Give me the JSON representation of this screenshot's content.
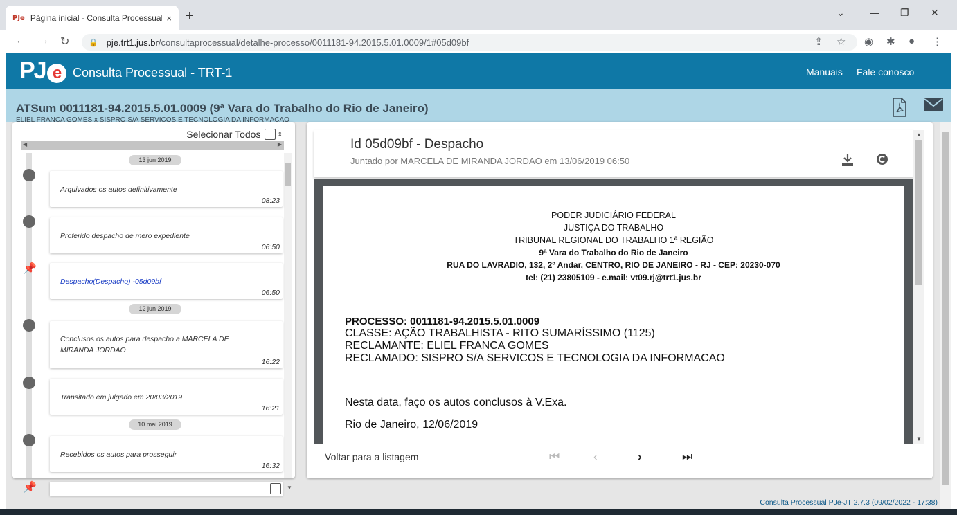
{
  "browser": {
    "tab_favicon": "PJe",
    "tab_title": "Página inicial - Consulta Processual",
    "tab_close": "×",
    "new_tab": "+",
    "url_host": "pje.trt1.jus.br",
    "url_path": "/consultaprocessual/detalhe-processo/0011181-94.2015.5.01.0009/1#05d09bf"
  },
  "app": {
    "title": "Consulta Processual - TRT-1",
    "links": {
      "manuals": "Manuais",
      "contact": "Fale conosco"
    }
  },
  "process": {
    "title": "ATSum 0011181-94.2015.5.01.0009 (9ª Vara do Trabalho do Rio de Janeiro)",
    "parties": "ELIEL FRANCA GOMES x SISPRO S/A SERVICOS E TECNOLOGIA DA INFORMACAO"
  },
  "timeline": {
    "select_all": "Selecionar Todos",
    "dates": [
      "13 jun 2019",
      "12 jun 2019",
      "10 mai 2019"
    ],
    "events": [
      {
        "text": "Arquivados os autos definitivamente",
        "time": "08:23"
      },
      {
        "text": "Proferido despacho de mero expediente",
        "time": "06:50"
      },
      {
        "text": "Despacho(Despacho) -05d09bf",
        "time": "06:50"
      },
      {
        "text": "Conclusos os autos para despacho a MARCELA DE MIRANDA JORDAO",
        "time": "16:22"
      },
      {
        "text": "Transitado em julgado em 20/03/2019",
        "time": "16:21"
      },
      {
        "text": "Recebidos os autos para prosseguir",
        "time": "16:32"
      }
    ]
  },
  "document": {
    "title": "Id 05d09bf - Despacho",
    "subtitle": "Juntado por MARCELA DE MIRANDA JORDAO em 13/06/2019 06:50",
    "header_lines": [
      "PODER JUDICIÁRIO FEDERAL",
      "JUSTIÇA DO TRABALHO",
      "TRIBUNAL REGIONAL DO TRABALHO 1ª REGIÃO",
      "9ª Vara do Trabalho do Rio de Janeiro",
      "RUA DO LAVRADIO, 132, 2º Andar, CENTRO, RIO DE JANEIRO - RJ - CEP: 20230-070",
      "tel: (21) 23805109  -  e.mail: vt09.rj@trt1.jus.br"
    ],
    "processo": "PROCESSO: 0011181-94.2015.5.01.0009",
    "classe": "CLASSE: AÇÃO TRABALHISTA - RITO SUMARÍSSIMO (1125)",
    "reclamante": "RECLAMANTE: ELIEL FRANCA GOMES",
    "reclamado": "RECLAMADO: SISPRO S/A SERVICOS E TECNOLOGIA DA INFORMACAO",
    "body1": "Nesta data, faço os autos conclusos à V.Exa.",
    "body2": "Rio de Janeiro, 12/06/2019",
    "back_link": "Voltar para a listagem"
  },
  "footer": {
    "version": "Consulta Processual PJe-JT 2.7.3 (09/02/2022 - 17:38)"
  },
  "colors": {
    "app_header": "#0f78a6",
    "process_bar": "#aed6e6",
    "logo_e": "#e53935",
    "link_blue": "#1a3dc5"
  }
}
